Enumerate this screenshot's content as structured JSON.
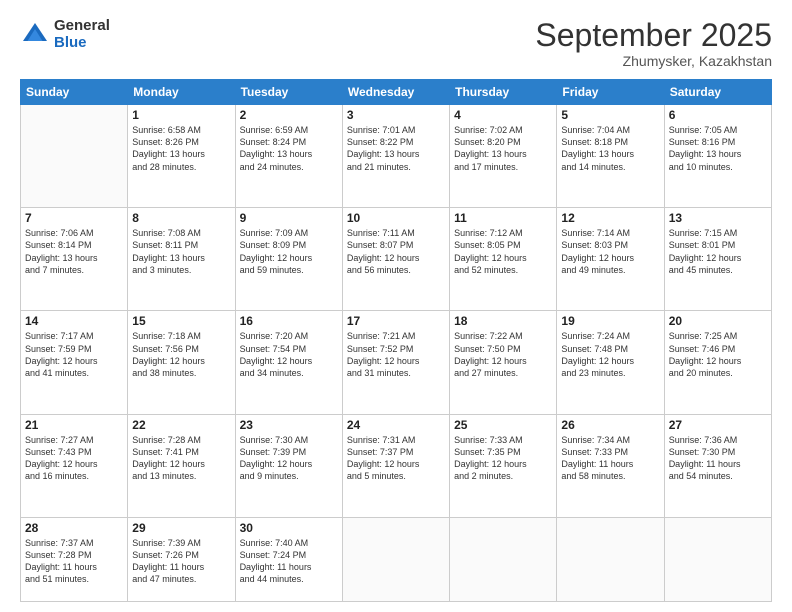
{
  "header": {
    "logo_general": "General",
    "logo_blue": "Blue",
    "month_title": "September 2025",
    "subtitle": "Zhumysker, Kazakhstan"
  },
  "days_of_week": [
    "Sunday",
    "Monday",
    "Tuesday",
    "Wednesday",
    "Thursday",
    "Friday",
    "Saturday"
  ],
  "weeks": [
    [
      {
        "day": "",
        "info": ""
      },
      {
        "day": "1",
        "info": "Sunrise: 6:58 AM\nSunset: 8:26 PM\nDaylight: 13 hours\nand 28 minutes."
      },
      {
        "day": "2",
        "info": "Sunrise: 6:59 AM\nSunset: 8:24 PM\nDaylight: 13 hours\nand 24 minutes."
      },
      {
        "day": "3",
        "info": "Sunrise: 7:01 AM\nSunset: 8:22 PM\nDaylight: 13 hours\nand 21 minutes."
      },
      {
        "day": "4",
        "info": "Sunrise: 7:02 AM\nSunset: 8:20 PM\nDaylight: 13 hours\nand 17 minutes."
      },
      {
        "day": "5",
        "info": "Sunrise: 7:04 AM\nSunset: 8:18 PM\nDaylight: 13 hours\nand 14 minutes."
      },
      {
        "day": "6",
        "info": "Sunrise: 7:05 AM\nSunset: 8:16 PM\nDaylight: 13 hours\nand 10 minutes."
      }
    ],
    [
      {
        "day": "7",
        "info": "Sunrise: 7:06 AM\nSunset: 8:14 PM\nDaylight: 13 hours\nand 7 minutes."
      },
      {
        "day": "8",
        "info": "Sunrise: 7:08 AM\nSunset: 8:11 PM\nDaylight: 13 hours\nand 3 minutes."
      },
      {
        "day": "9",
        "info": "Sunrise: 7:09 AM\nSunset: 8:09 PM\nDaylight: 12 hours\nand 59 minutes."
      },
      {
        "day": "10",
        "info": "Sunrise: 7:11 AM\nSunset: 8:07 PM\nDaylight: 12 hours\nand 56 minutes."
      },
      {
        "day": "11",
        "info": "Sunrise: 7:12 AM\nSunset: 8:05 PM\nDaylight: 12 hours\nand 52 minutes."
      },
      {
        "day": "12",
        "info": "Sunrise: 7:14 AM\nSunset: 8:03 PM\nDaylight: 12 hours\nand 49 minutes."
      },
      {
        "day": "13",
        "info": "Sunrise: 7:15 AM\nSunset: 8:01 PM\nDaylight: 12 hours\nand 45 minutes."
      }
    ],
    [
      {
        "day": "14",
        "info": "Sunrise: 7:17 AM\nSunset: 7:59 PM\nDaylight: 12 hours\nand 41 minutes."
      },
      {
        "day": "15",
        "info": "Sunrise: 7:18 AM\nSunset: 7:56 PM\nDaylight: 12 hours\nand 38 minutes."
      },
      {
        "day": "16",
        "info": "Sunrise: 7:20 AM\nSunset: 7:54 PM\nDaylight: 12 hours\nand 34 minutes."
      },
      {
        "day": "17",
        "info": "Sunrise: 7:21 AM\nSunset: 7:52 PM\nDaylight: 12 hours\nand 31 minutes."
      },
      {
        "day": "18",
        "info": "Sunrise: 7:22 AM\nSunset: 7:50 PM\nDaylight: 12 hours\nand 27 minutes."
      },
      {
        "day": "19",
        "info": "Sunrise: 7:24 AM\nSunset: 7:48 PM\nDaylight: 12 hours\nand 23 minutes."
      },
      {
        "day": "20",
        "info": "Sunrise: 7:25 AM\nSunset: 7:46 PM\nDaylight: 12 hours\nand 20 minutes."
      }
    ],
    [
      {
        "day": "21",
        "info": "Sunrise: 7:27 AM\nSunset: 7:43 PM\nDaylight: 12 hours\nand 16 minutes."
      },
      {
        "day": "22",
        "info": "Sunrise: 7:28 AM\nSunset: 7:41 PM\nDaylight: 12 hours\nand 13 minutes."
      },
      {
        "day": "23",
        "info": "Sunrise: 7:30 AM\nSunset: 7:39 PM\nDaylight: 12 hours\nand 9 minutes."
      },
      {
        "day": "24",
        "info": "Sunrise: 7:31 AM\nSunset: 7:37 PM\nDaylight: 12 hours\nand 5 minutes."
      },
      {
        "day": "25",
        "info": "Sunrise: 7:33 AM\nSunset: 7:35 PM\nDaylight: 12 hours\nand 2 minutes."
      },
      {
        "day": "26",
        "info": "Sunrise: 7:34 AM\nSunset: 7:33 PM\nDaylight: 11 hours\nand 58 minutes."
      },
      {
        "day": "27",
        "info": "Sunrise: 7:36 AM\nSunset: 7:30 PM\nDaylight: 11 hours\nand 54 minutes."
      }
    ],
    [
      {
        "day": "28",
        "info": "Sunrise: 7:37 AM\nSunset: 7:28 PM\nDaylight: 11 hours\nand 51 minutes."
      },
      {
        "day": "29",
        "info": "Sunrise: 7:39 AM\nSunset: 7:26 PM\nDaylight: 11 hours\nand 47 minutes."
      },
      {
        "day": "30",
        "info": "Sunrise: 7:40 AM\nSunset: 7:24 PM\nDaylight: 11 hours\nand 44 minutes."
      },
      {
        "day": "",
        "info": ""
      },
      {
        "day": "",
        "info": ""
      },
      {
        "day": "",
        "info": ""
      },
      {
        "day": "",
        "info": ""
      }
    ]
  ]
}
